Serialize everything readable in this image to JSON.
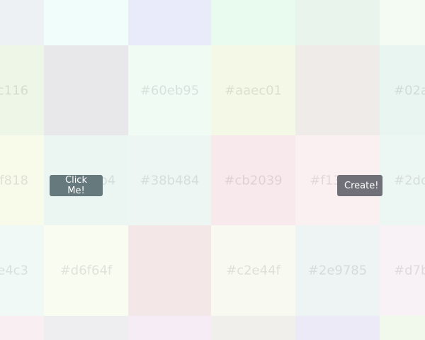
{
  "buttons": {
    "click_me": "Click Me!",
    "create": "Create!"
  },
  "tiles": [
    {
      "label": "",
      "bg": "#edf1f4"
    },
    {
      "label": "",
      "bg": "#f1fdfb"
    },
    {
      "label": "",
      "bg": "#e9ebfa"
    },
    {
      "label": "",
      "bg": "#e9fbee"
    },
    {
      "label": "",
      "bg": "#e9f4ec"
    },
    {
      "label": "",
      "bg": "#f3fbf2"
    },
    {
      "label": "c116",
      "bg": "#eef6e8"
    },
    {
      "label": "",
      "bg": "#e8e8ea"
    },
    {
      "label": "#60eb95",
      "bg": "#f0fbf4"
    },
    {
      "label": "#aaec01",
      "bg": "#f3f9e6"
    },
    {
      "label": "",
      "bg": "#eeebe8"
    },
    {
      "label": "#02a",
      "bg": "#e9f5f1"
    },
    {
      "label": "f818",
      "bg": "#f8faea"
    },
    {
      "label": "#21e7b4",
      "bg": "#ebf6f3"
    },
    {
      "label": "#38b484",
      "bg": "#edf6f3"
    },
    {
      "label": "#cb2039",
      "bg": "#f8e9ed"
    },
    {
      "label": "#f1307a",
      "bg": "#fbf0f1"
    },
    {
      "label": "#2dc",
      "bg": "#ecf7f4"
    },
    {
      "label": "e4c3",
      "bg": "#f1f9f7"
    },
    {
      "label": "#d6f64f",
      "bg": "#f9fcf1"
    },
    {
      "label": "",
      "bg": "#f4e7e8"
    },
    {
      "label": "#c2e44f",
      "bg": "#f8faf1"
    },
    {
      "label": "#2e9785",
      "bg": "#edf4f3"
    },
    {
      "label": "#d7b",
      "bg": "#f8f2f7"
    },
    {
      "label": "",
      "bg": "#f9eef2"
    },
    {
      "label": "",
      "bg": "#eeeef0"
    },
    {
      "label": "",
      "bg": "#f6ecf6"
    },
    {
      "label": "",
      "bg": "#f0efec"
    },
    {
      "label": "",
      "bg": "#eceaf6"
    },
    {
      "label": "",
      "bg": "#f0f9ec"
    }
  ]
}
